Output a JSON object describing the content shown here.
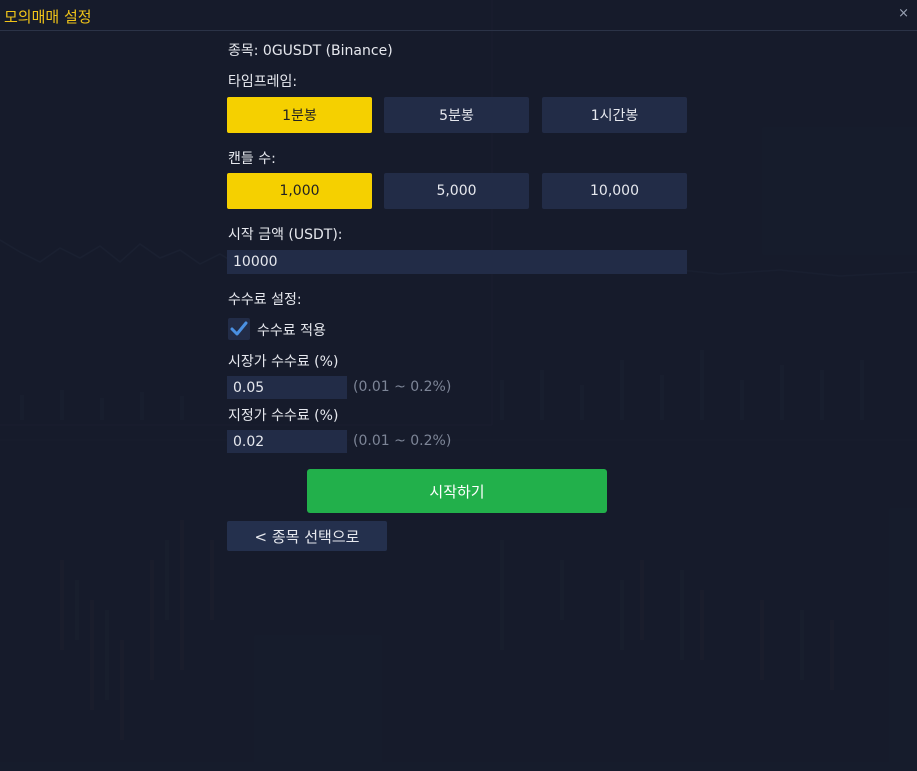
{
  "window": {
    "title": "모의매매 설정",
    "close_glyph": "×"
  },
  "symbol": {
    "text": "종목: 0GUSDT (Binance)"
  },
  "timeframe": {
    "label": "타임프레임:",
    "options": [
      "1분봉",
      "5분봉",
      "1시간봉"
    ],
    "selected": "1분봉"
  },
  "candles": {
    "label": "캔들 수:",
    "options": [
      "1,000",
      "5,000",
      "10,000"
    ],
    "selected": "1,000"
  },
  "start_amount": {
    "label": "시작 금액 (USDT):",
    "value": "10000"
  },
  "fee": {
    "section_label": "수수료 설정:",
    "apply_label": "수수료 적용",
    "apply_checked": true,
    "market_label": "시장가 수수료 (%)",
    "market_value": "0.05",
    "market_hint": "(0.01 ~ 0.2%)",
    "limit_label": "지정가 수수료 (%)",
    "limit_value": "0.02",
    "limit_hint": "(0.01 ~ 0.2%)"
  },
  "actions": {
    "start_label": "시작하기",
    "back_label": "< 종목 선택으로"
  },
  "colors": {
    "background": "#161c2c",
    "accent_yellow": "#f5d000",
    "title_yellow": "#f0c419",
    "button_green": "#22b04b",
    "checkbox_blue": "#4a90e2",
    "option_bg": "#222c47"
  }
}
